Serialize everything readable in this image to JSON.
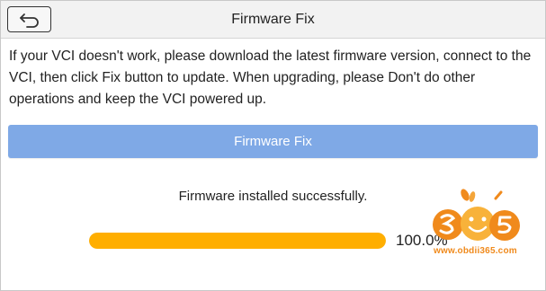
{
  "header": {
    "title": "Firmware Fix",
    "back_icon": "back-arrow-icon"
  },
  "main": {
    "instructions": "If your VCI doesn't work, please download the latest firmware version, connect to the VCI, then click Fix button to update. When upgrading, please Don't do other operations and keep the VCI powered up.",
    "fix_button_label": "Firmware Fix",
    "status_text": "Firmware installed successfully.",
    "progress": {
      "fraction": 1.0,
      "label": "100.0%"
    }
  },
  "watermark": {
    "url": "www.obdii365.com"
  },
  "colors": {
    "button_bg": "#7fa9e6",
    "progress_fill": "#ffae00",
    "titlebar_bg": "#f2f2f2"
  }
}
